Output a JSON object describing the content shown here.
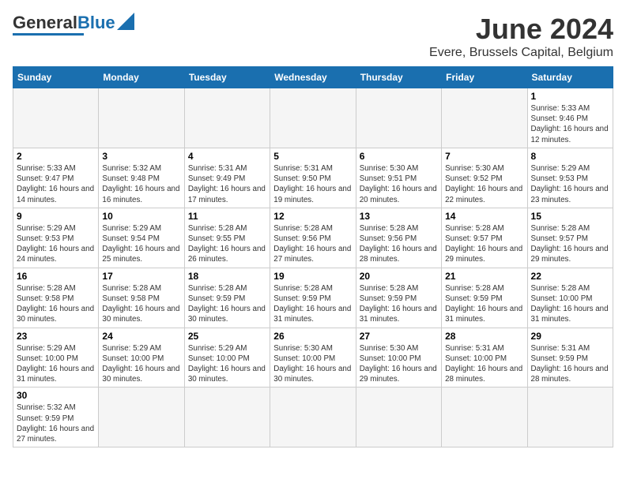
{
  "header": {
    "logo_general": "General",
    "logo_blue": "Blue",
    "month_title": "June 2024",
    "location": "Evere, Brussels Capital, Belgium"
  },
  "days_of_week": [
    "Sunday",
    "Monday",
    "Tuesday",
    "Wednesday",
    "Thursday",
    "Friday",
    "Saturday"
  ],
  "weeks": [
    [
      {
        "day": "",
        "info": ""
      },
      {
        "day": "",
        "info": ""
      },
      {
        "day": "",
        "info": ""
      },
      {
        "day": "",
        "info": ""
      },
      {
        "day": "",
        "info": ""
      },
      {
        "day": "",
        "info": ""
      },
      {
        "day": "1",
        "info": "Sunrise: 5:33 AM\nSunset: 9:46 PM\nDaylight: 16 hours\nand 12 minutes."
      }
    ],
    [
      {
        "day": "2",
        "info": "Sunrise: 5:33 AM\nSunset: 9:47 PM\nDaylight: 16 hours\nand 14 minutes."
      },
      {
        "day": "3",
        "info": "Sunrise: 5:32 AM\nSunset: 9:48 PM\nDaylight: 16 hours\nand 16 minutes."
      },
      {
        "day": "4",
        "info": "Sunrise: 5:31 AM\nSunset: 9:49 PM\nDaylight: 16 hours\nand 17 minutes."
      },
      {
        "day": "5",
        "info": "Sunrise: 5:31 AM\nSunset: 9:50 PM\nDaylight: 16 hours\nand 19 minutes."
      },
      {
        "day": "6",
        "info": "Sunrise: 5:30 AM\nSunset: 9:51 PM\nDaylight: 16 hours\nand 20 minutes."
      },
      {
        "day": "7",
        "info": "Sunrise: 5:30 AM\nSunset: 9:52 PM\nDaylight: 16 hours\nand 22 minutes."
      },
      {
        "day": "8",
        "info": "Sunrise: 5:29 AM\nSunset: 9:53 PM\nDaylight: 16 hours\nand 23 minutes."
      }
    ],
    [
      {
        "day": "9",
        "info": "Sunrise: 5:29 AM\nSunset: 9:53 PM\nDaylight: 16 hours\nand 24 minutes."
      },
      {
        "day": "10",
        "info": "Sunrise: 5:29 AM\nSunset: 9:54 PM\nDaylight: 16 hours\nand 25 minutes."
      },
      {
        "day": "11",
        "info": "Sunrise: 5:28 AM\nSunset: 9:55 PM\nDaylight: 16 hours\nand 26 minutes."
      },
      {
        "day": "12",
        "info": "Sunrise: 5:28 AM\nSunset: 9:56 PM\nDaylight: 16 hours\nand 27 minutes."
      },
      {
        "day": "13",
        "info": "Sunrise: 5:28 AM\nSunset: 9:56 PM\nDaylight: 16 hours\nand 28 minutes."
      },
      {
        "day": "14",
        "info": "Sunrise: 5:28 AM\nSunset: 9:57 PM\nDaylight: 16 hours\nand 29 minutes."
      },
      {
        "day": "15",
        "info": "Sunrise: 5:28 AM\nSunset: 9:57 PM\nDaylight: 16 hours\nand 29 minutes."
      }
    ],
    [
      {
        "day": "16",
        "info": "Sunrise: 5:28 AM\nSunset: 9:58 PM\nDaylight: 16 hours\nand 30 minutes."
      },
      {
        "day": "17",
        "info": "Sunrise: 5:28 AM\nSunset: 9:58 PM\nDaylight: 16 hours\nand 30 minutes."
      },
      {
        "day": "18",
        "info": "Sunrise: 5:28 AM\nSunset: 9:59 PM\nDaylight: 16 hours\nand 30 minutes."
      },
      {
        "day": "19",
        "info": "Sunrise: 5:28 AM\nSunset: 9:59 PM\nDaylight: 16 hours\nand 31 minutes."
      },
      {
        "day": "20",
        "info": "Sunrise: 5:28 AM\nSunset: 9:59 PM\nDaylight: 16 hours\nand 31 minutes."
      },
      {
        "day": "21",
        "info": "Sunrise: 5:28 AM\nSunset: 9:59 PM\nDaylight: 16 hours\nand 31 minutes."
      },
      {
        "day": "22",
        "info": "Sunrise: 5:28 AM\nSunset: 10:00 PM\nDaylight: 16 hours\nand 31 minutes."
      }
    ],
    [
      {
        "day": "23",
        "info": "Sunrise: 5:29 AM\nSunset: 10:00 PM\nDaylight: 16 hours\nand 31 minutes."
      },
      {
        "day": "24",
        "info": "Sunrise: 5:29 AM\nSunset: 10:00 PM\nDaylight: 16 hours\nand 30 minutes."
      },
      {
        "day": "25",
        "info": "Sunrise: 5:29 AM\nSunset: 10:00 PM\nDaylight: 16 hours\nand 30 minutes."
      },
      {
        "day": "26",
        "info": "Sunrise: 5:30 AM\nSunset: 10:00 PM\nDaylight: 16 hours\nand 30 minutes."
      },
      {
        "day": "27",
        "info": "Sunrise: 5:30 AM\nSunset: 10:00 PM\nDaylight: 16 hours\nand 29 minutes."
      },
      {
        "day": "28",
        "info": "Sunrise: 5:31 AM\nSunset: 10:00 PM\nDaylight: 16 hours\nand 28 minutes."
      },
      {
        "day": "29",
        "info": "Sunrise: 5:31 AM\nSunset: 9:59 PM\nDaylight: 16 hours\nand 28 minutes."
      }
    ],
    [
      {
        "day": "30",
        "info": "Sunrise: 5:32 AM\nSunset: 9:59 PM\nDaylight: 16 hours\nand 27 minutes."
      },
      {
        "day": "",
        "info": ""
      },
      {
        "day": "",
        "info": ""
      },
      {
        "day": "",
        "info": ""
      },
      {
        "day": "",
        "info": ""
      },
      {
        "day": "",
        "info": ""
      },
      {
        "day": "",
        "info": ""
      }
    ]
  ]
}
